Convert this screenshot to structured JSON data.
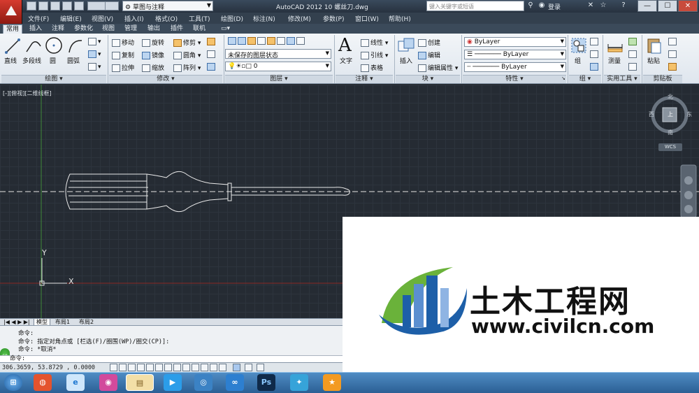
{
  "window": {
    "title": "AutoCAD 2012    10 螺丝刀.dwg",
    "workspace": "草图与注释",
    "search_placeholder": "键入关键字或短语",
    "login": "登录",
    "min_label": "—",
    "max_label": "☐",
    "close_label": "✕"
  },
  "menu": [
    "文件(F)",
    "编辑(E)",
    "视图(V)",
    "插入(I)",
    "格式(O)",
    "工具(T)",
    "绘图(D)",
    "标注(N)",
    "修改(M)",
    "参数(P)",
    "窗口(W)",
    "帮助(H)"
  ],
  "ribbon_tabs": [
    "常用",
    "插入",
    "注释",
    "参数化",
    "视图",
    "管理",
    "输出",
    "插件",
    "联机"
  ],
  "panels": {
    "draw": {
      "label": "绘图 ▾",
      "line": "直线",
      "polyline": "多段线",
      "circle": "圆",
      "arc": "圆弧"
    },
    "modify": {
      "label": "修改 ▾",
      "move": "移动",
      "rotate": "旋转",
      "trim": "修剪",
      "copy": "复制",
      "mirror": "镜像",
      "fillet": "圆角",
      "stretch": "拉伸",
      "scale": "缩放",
      "array": "阵列"
    },
    "layers": {
      "label": "图层 ▾",
      "state": "未保存的图层状态",
      "current_layer": "0"
    },
    "annotation": {
      "label": "注释 ▾",
      "text": "文字",
      "linear": "线性",
      "leader": "引线",
      "table": "表格"
    },
    "block": {
      "label": "块 ▾",
      "insert": "插入",
      "create": "创建",
      "edit": "编辑",
      "edit_attr": "编辑属性"
    },
    "properties": {
      "label": "特性 ▾",
      "color": "ByLayer",
      "linetype": "ByLayer",
      "lineweight": "ByLayer"
    },
    "group": {
      "label": "组 ▾",
      "group": "组"
    },
    "utilities": {
      "label": "实用工具 ▾",
      "measure": "测量"
    },
    "clipboard": {
      "label": "剪贴板",
      "paste": "粘贴"
    }
  },
  "viewport_label": "[-][俯视][二维线框]",
  "viewcube": {
    "north": "北",
    "south": "南",
    "east": "东",
    "west": "西",
    "top": "上",
    "wcs": "WCS"
  },
  "ucs": {
    "x": "X",
    "y": "Y"
  },
  "layout_tabs": [
    "模型",
    "布局1",
    "布局2"
  ],
  "command_history": [
    "命令:",
    "命令: 指定对角点或 [栏选(F)/圈围(WP)/圈交(CP)]:",
    "命令: *取消*"
  ],
  "command_prompt": "命令:",
  "cmd_badge": "60",
  "coordinates": "306.3659, 53.8729 , 0.0000",
  "watermark": {
    "name": "土木工程网",
    "url": "www.civilcn.com"
  },
  "taskbar": [
    "⊞",
    "◍",
    "e",
    "◉",
    "▤",
    "▶",
    "◎",
    "∞",
    "Ps",
    "✦",
    "★"
  ],
  "colors": {
    "canvas": "#252b33",
    "accent": "#3f6fa8",
    "watermark_blue": "#1d5fa8",
    "watermark_green": "#6ab23a"
  }
}
